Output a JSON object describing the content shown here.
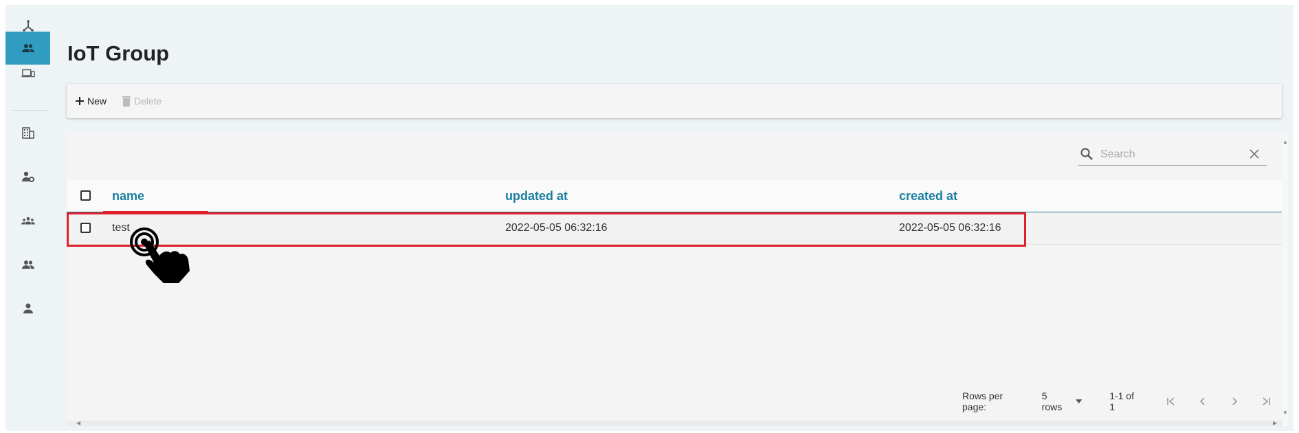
{
  "page": {
    "title": "IoT Group"
  },
  "sidebar": {
    "items": [
      {
        "icon": "network-icon"
      },
      {
        "icon": "group-icon",
        "active": true
      },
      {
        "icon": "devices-icon"
      },
      {
        "icon": "building-icon"
      },
      {
        "icon": "user-settings-icon"
      },
      {
        "icon": "team-icon"
      },
      {
        "icon": "people-icon"
      },
      {
        "icon": "person-icon"
      }
    ]
  },
  "toolbar": {
    "new_label": "New",
    "delete_label": "Delete"
  },
  "search": {
    "placeholder": "Search",
    "value": ""
  },
  "table": {
    "columns": [
      "name",
      "updated at",
      "created at"
    ],
    "rows": [
      {
        "name": "test",
        "updated_at": "2022-05-05 06:32:16",
        "created_at": "2022-05-05 06:32:16"
      }
    ]
  },
  "pagination": {
    "rows_per_page_label": "Rows per page:",
    "rows_per_page_value": "5 rows",
    "range": "1-1 of 1"
  },
  "colors": {
    "accent": "#2f9cc0",
    "header_text": "#1a7fa0",
    "highlight": "#e0202b"
  }
}
